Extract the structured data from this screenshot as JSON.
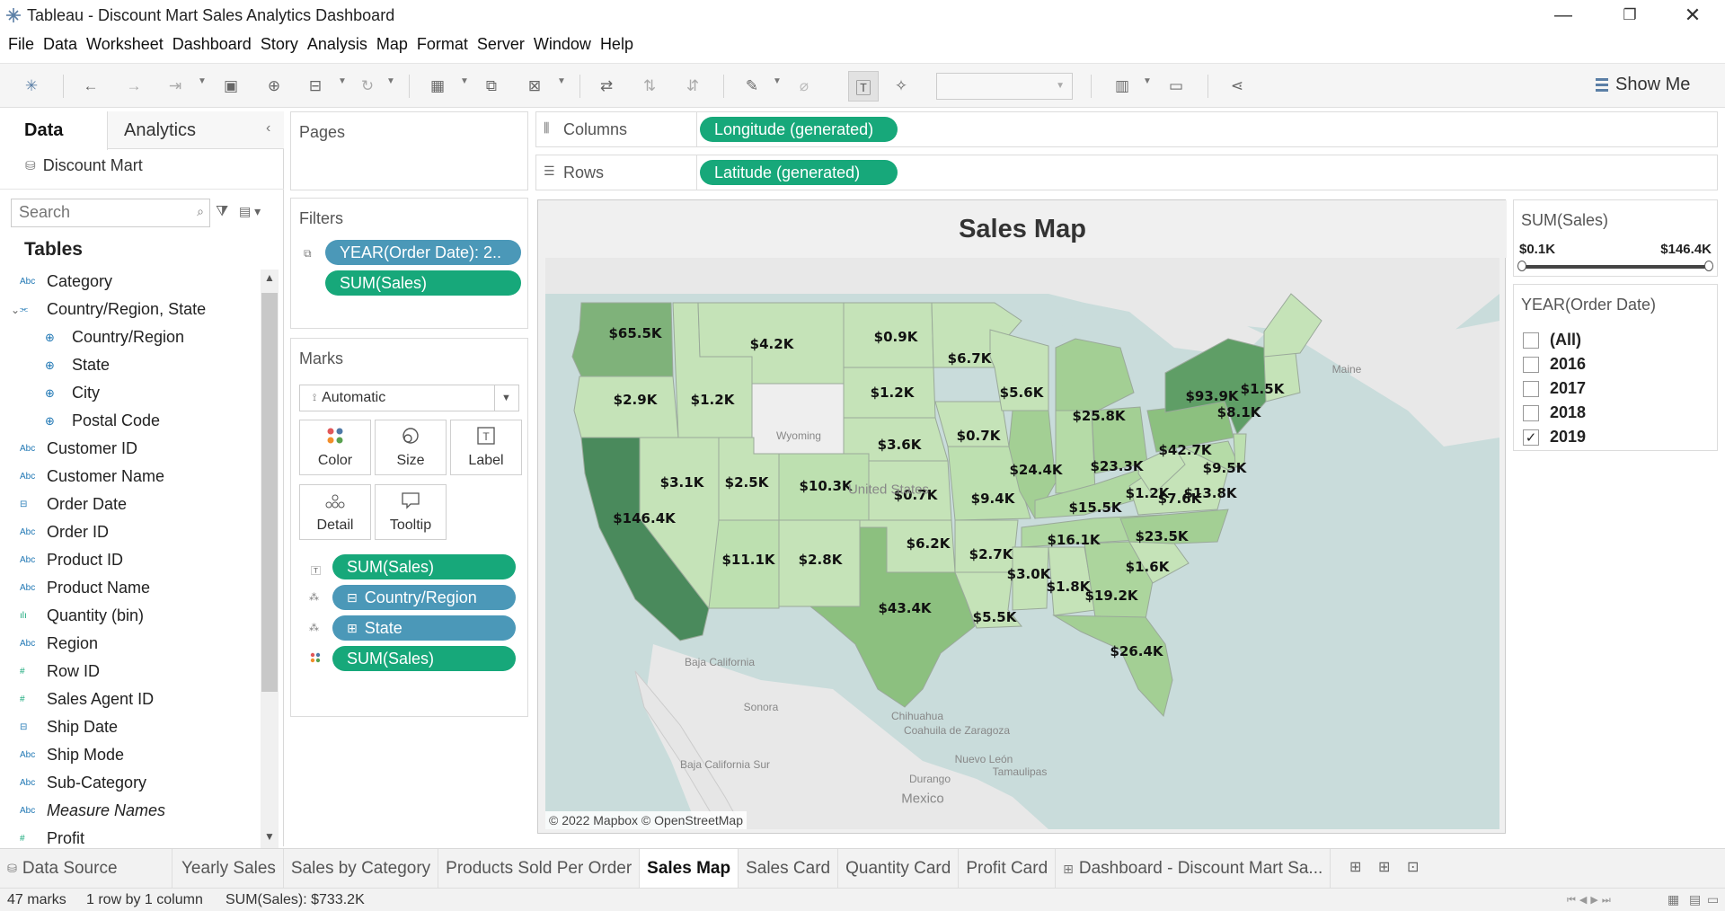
{
  "window": {
    "title": "Tableau - Discount Mart Sales Analytics Dashboard"
  },
  "menu": [
    "File",
    "Data",
    "Worksheet",
    "Dashboard",
    "Story",
    "Analysis",
    "Map",
    "Format",
    "Server",
    "Window",
    "Help"
  ],
  "toolbar": {
    "show_me": "Show Me"
  },
  "left_pane": {
    "tab_data": "Data",
    "tab_analytics": "Analytics",
    "datasource": "Discount Mart",
    "search_placeholder": "Search",
    "tables_heading": "Tables",
    "fields": [
      {
        "icon": "Abc",
        "label": "Category",
        "indent": 0
      },
      {
        "icon": "hier",
        "label": "Country/Region, State",
        "indent": 0,
        "expanded": true
      },
      {
        "icon": "geo",
        "label": "Country/Region",
        "indent": 1
      },
      {
        "icon": "geo",
        "label": "State",
        "indent": 1
      },
      {
        "icon": "geo",
        "label": "City",
        "indent": 1
      },
      {
        "icon": "geo",
        "label": "Postal Code",
        "indent": 1
      },
      {
        "icon": "Abc",
        "label": "Customer ID",
        "indent": 0
      },
      {
        "icon": "Abc",
        "label": "Customer Name",
        "indent": 0
      },
      {
        "icon": "date",
        "label": "Order Date",
        "indent": 0
      },
      {
        "icon": "Abc",
        "label": "Order ID",
        "indent": 0
      },
      {
        "icon": "Abc",
        "label": "Product ID",
        "indent": 0
      },
      {
        "icon": "Abc",
        "label": "Product Name",
        "indent": 0
      },
      {
        "icon": "bin",
        "label": "Quantity (bin)",
        "indent": 0
      },
      {
        "icon": "Abc",
        "label": "Region",
        "indent": 0
      },
      {
        "icon": "#",
        "label": "Row ID",
        "indent": 0
      },
      {
        "icon": "#",
        "label": "Sales Agent ID",
        "indent": 0
      },
      {
        "icon": "date",
        "label": "Ship Date",
        "indent": 0
      },
      {
        "icon": "Abc",
        "label": "Ship Mode",
        "indent": 0
      },
      {
        "icon": "Abc",
        "label": "Sub-Category",
        "indent": 0
      },
      {
        "icon": "Abc",
        "label": "Measure Names",
        "indent": 0,
        "italic": true
      },
      {
        "icon": "#",
        "label": "Profit",
        "indent": 0
      }
    ]
  },
  "pages": {
    "label": "Pages"
  },
  "filters": {
    "label": "Filters",
    "pills": [
      "YEAR(Order Date): 2..",
      "SUM(Sales)"
    ]
  },
  "marks": {
    "label": "Marks",
    "type": "Automatic",
    "buttons": [
      "Color",
      "Size",
      "Label",
      "Detail",
      "Tooltip"
    ],
    "pills": [
      {
        "label": "SUM(Sales)",
        "color": "green",
        "icon": "label"
      },
      {
        "label": "Country/Region",
        "color": "blue",
        "icon": "detail",
        "prefix": "⊟"
      },
      {
        "label": "State",
        "color": "blue",
        "icon": "detail",
        "prefix": "⊞"
      },
      {
        "label": "SUM(Sales)",
        "color": "green",
        "icon": "color"
      }
    ]
  },
  "columns": {
    "label": "Columns",
    "pill": "Longitude (generated)"
  },
  "rows": {
    "label": "Rows",
    "pill": "Latitude (generated)"
  },
  "viz": {
    "title": "Sales Map",
    "attribution": "© 2022 Mapbox © OpenStreetMap",
    "states": [
      {
        "name": "WA",
        "label": "$65.5K",
        "color": "#7fb27a"
      },
      {
        "name": "OR",
        "label": "$2.9K",
        "color": "#c5e3b8"
      },
      {
        "name": "CA",
        "label": "$146.4K",
        "color": "#4a8a5c"
      },
      {
        "name": "ID",
        "label": "$1.2K",
        "color": "#c5e3b8"
      },
      {
        "name": "NV",
        "label": "$3.1K",
        "color": "#c5e3b8"
      },
      {
        "name": "MT",
        "label": "$4.2K",
        "color": "#c5e3b8"
      },
      {
        "name": "WY",
        "label": "",
        "color": "#eeeeee"
      },
      {
        "name": "UT",
        "label": "$2.5K",
        "color": "#c5e3b8"
      },
      {
        "name": "AZ",
        "label": "$11.1K",
        "color": "#bde0b0"
      },
      {
        "name": "CO",
        "label": "$10.3K",
        "color": "#bde0b0"
      },
      {
        "name": "NM",
        "label": "$2.8K",
        "color": "#c5e3b8"
      },
      {
        "name": "ND",
        "label": "$0.9K",
        "color": "#c5e3b8"
      },
      {
        "name": "SD",
        "label": "$1.2K",
        "color": "#c5e3b8"
      },
      {
        "name": "NE",
        "label": "$3.6K",
        "color": "#c5e3b8"
      },
      {
        "name": "KS",
        "label": "$0.7K",
        "color": "#c5e3b8"
      },
      {
        "name": "OK",
        "label": "$6.2K",
        "color": "#c5e3b8"
      },
      {
        "name": "TX",
        "label": "$43.4K",
        "color": "#8cc07f"
      },
      {
        "name": "MN",
        "label": "$6.7K",
        "color": "#c5e3b8"
      },
      {
        "name": "IA",
        "label": "$0.7K",
        "color": "#c5e3b8"
      },
      {
        "name": "MO",
        "label": "$9.4K",
        "color": "#bde0b0"
      },
      {
        "name": "AR",
        "label": "$2.7K",
        "color": "#c5e3b8"
      },
      {
        "name": "LA",
        "label": "$5.5K",
        "color": "#c5e3b8"
      },
      {
        "name": "WI",
        "label": "$5.6K",
        "color": "#c5e3b8"
      },
      {
        "name": "IL",
        "label": "$24.4K",
        "color": "#a3cf94"
      },
      {
        "name": "MI",
        "label": "$25.8K",
        "color": "#a3cf94"
      },
      {
        "name": "IN",
        "label": "",
        "color": "#b5dba7"
      },
      {
        "name": "OH",
        "label": "$23.3K",
        "color": "#a3cf94"
      },
      {
        "name": "KY",
        "label": "$15.5K",
        "color": "#b0d8a2"
      },
      {
        "name": "TN",
        "label": "$16.1K",
        "color": "#b0d8a2"
      },
      {
        "name": "MS",
        "label": "$3.0K",
        "color": "#c5e3b8"
      },
      {
        "name": "AL",
        "label": "$1.8K",
        "color": "#c5e3b8"
      },
      {
        "name": "GA",
        "label": "$19.2K",
        "color": "#acd59d"
      },
      {
        "name": "FL",
        "label": "$26.4K",
        "color": "#a3cf94"
      },
      {
        "name": "SC",
        "label": "$1.6K",
        "color": "#c5e3b8"
      },
      {
        "name": "NC",
        "label": "$23.5K",
        "color": "#a3cf94"
      },
      {
        "name": "VA",
        "label": "$7.6K",
        "color": "#c5e3b8"
      },
      {
        "name": "WV",
        "label": "$1.2K",
        "color": "#c5e3b8"
      },
      {
        "name": "PA",
        "label": "$42.7K",
        "color": "#8cc07f"
      },
      {
        "name": "NY",
        "label": "$93.9K",
        "color": "#5f9e66"
      },
      {
        "name": "MD",
        "label": "$13.8K",
        "color": "#b5dba7"
      },
      {
        "name": "NJ",
        "label": "$9.5K",
        "color": "#bde0b0"
      },
      {
        "name": "NE-states",
        "label": "$8.1K",
        "color": "#c5e3b8"
      },
      {
        "name": "ME",
        "label": "$1.5K",
        "color": "#c5e3b8"
      }
    ],
    "geo_labels": [
      "Wyoming",
      "Maine",
      "United States",
      "Sonora",
      "Chihuahua",
      "Coahuila de Zaragoza",
      "Nuevo León",
      "Tamaulipas",
      "Baja California Sur",
      "Durango",
      "Baja California",
      "Mexico"
    ]
  },
  "legend_sales": {
    "title": "SUM(Sales)",
    "min": "$0.1K",
    "max": "$146.4K"
  },
  "legend_year": {
    "title": "YEAR(Order Date)",
    "items": [
      {
        "label": "(All)",
        "checked": false
      },
      {
        "label": "2016",
        "checked": false
      },
      {
        "label": "2017",
        "checked": false
      },
      {
        "label": "2018",
        "checked": false
      },
      {
        "label": "2019",
        "checked": true
      }
    ]
  },
  "sheet_tabs": {
    "datasource": "Data Source",
    "tabs": [
      "Yearly Sales",
      "Sales by Category",
      "Products Sold Per Order",
      "Sales Map",
      "Sales Card",
      "Quantity Card",
      "Profit Card",
      "Dashboard - Discount Mart Sa..."
    ],
    "active": "Sales Map"
  },
  "status": {
    "marks": "47 marks",
    "rows": "1 row by 1 column",
    "sum": "SUM(Sales): $733.2K"
  }
}
